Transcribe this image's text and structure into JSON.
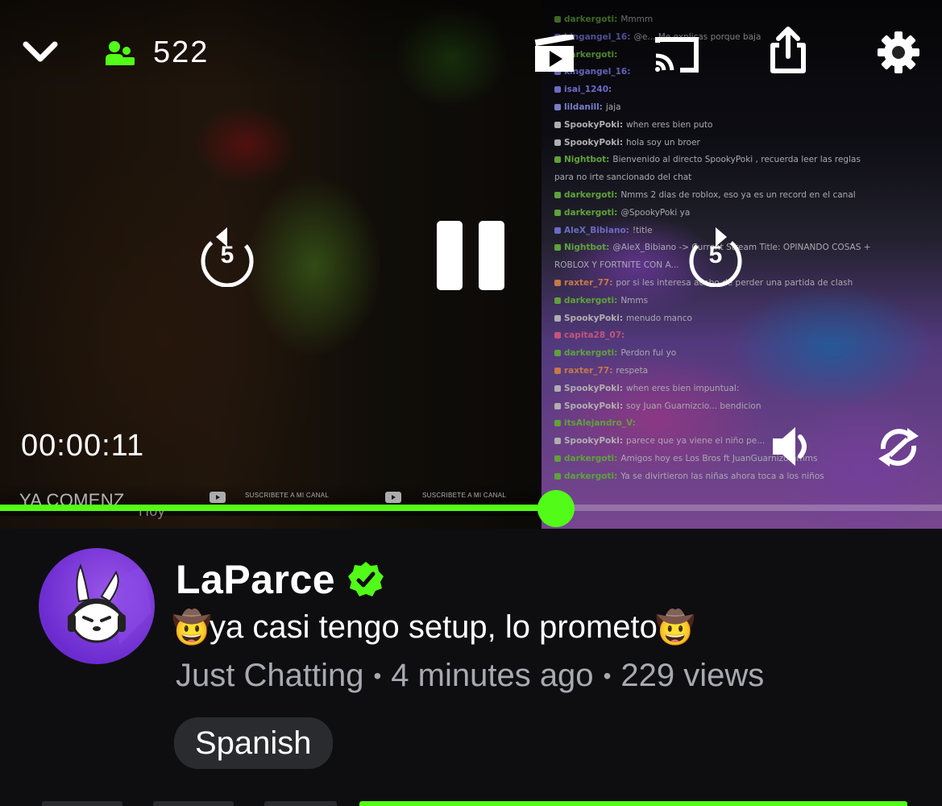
{
  "player": {
    "viewer_count": "522",
    "elapsed_time": "00:00:11",
    "rewind_seconds": "5",
    "forward_seconds": "5",
    "progress_fraction": 0.59,
    "banner": {
      "left_text": "YA COMENZ",
      "left_text_2": "Hoy",
      "subscribe_1": "SUSCRIBETE A MI CANAL",
      "subscribe_2": "SUSCRIBETE A MI CANAL"
    },
    "icons": {
      "collapse": "chevron-down-icon",
      "viewers": "viewers-icon",
      "clip": "clip-icon",
      "cast": "cast-icon",
      "share": "share-icon",
      "settings": "gear-icon",
      "rewind": "rewind-5-icon",
      "pause": "pause-icon",
      "forward": "forward-5-icon",
      "volume": "volume-icon",
      "rotate": "rotate-icon"
    }
  },
  "chat_overlay": [
    {
      "user": "darkergoti",
      "text": "Mmmm",
      "color": "#7ad04a"
    },
    {
      "user": "kingangel_16",
      "text": "@e... Me explicas porque baja",
      "color": "#8a8aff"
    },
    {
      "user": "darkergoti",
      "text": "",
      "color": "#7ad04a"
    },
    {
      "user": "kingangel_16",
      "text": "",
      "color": "#8a8aff"
    },
    {
      "user": "isai_1240",
      "text": "",
      "color": "#8a8aff"
    },
    {
      "user": "lildanill",
      "text": "jaja",
      "color": "#9aa0ff"
    },
    {
      "user": "SpookyPoki",
      "text": "when eres bien puto",
      "color": "#e0e0e0"
    },
    {
      "user": "SpookyPoki",
      "text": "hola soy un broer",
      "color": "#e0e0e0"
    },
    {
      "user": "Nightbot",
      "text": "Bienvenido al directo SpookyPoki , recuerda leer las reglas",
      "color": "#7ad04a"
    },
    {
      "user": "",
      "text": "para no irte sancionado del chat",
      "color": "#e0e0e0"
    },
    {
      "user": "darkergoti",
      "text": "Nmms 2 dias de roblox, eso ya es un record en el canal",
      "color": "#7ad04a"
    },
    {
      "user": "darkergoti",
      "text": "@SpookyPoki ya",
      "color": "#7ad04a"
    },
    {
      "user": "AleX_Bibiano",
      "text": "!title",
      "color": "#8a8aff"
    },
    {
      "user": "Nightbot",
      "text": "@AleX_Bibiano -> Current Stream Title: OPINANDO COSAS +",
      "color": "#7ad04a"
    },
    {
      "user": "",
      "text": "ROBLOX Y FORTNITE CON A...",
      "color": "#e0e0e0"
    },
    {
      "user": "raxter_77",
      "text": "por si les interesa acabo de perder una partida de clash",
      "color": "#ff9a5a"
    },
    {
      "user": "darkergoti",
      "text": "Nmms",
      "color": "#7ad04a"
    },
    {
      "user": "SpookyPoki",
      "text": "menudo manco",
      "color": "#e0e0e0"
    },
    {
      "user": "capita28_07",
      "text": "",
      "color": "#ff6aa0"
    },
    {
      "user": "darkergoti",
      "text": "Perdon fui yo",
      "color": "#7ad04a"
    },
    {
      "user": "raxter_77",
      "text": "respeta",
      "color": "#ff9a5a"
    },
    {
      "user": "SpookyPoki",
      "text": "when eres bien impuntual:",
      "color": "#e0e0e0"
    },
    {
      "user": "SpookyPoki",
      "text": "soy Juan Guarnizcio... bendicion",
      "color": "#e0e0e0"
    },
    {
      "user": "itsAlejandro_V",
      "text": "",
      "color": "#7ad04a"
    },
    {
      "user": "SpookyPoki",
      "text": "parece que ya viene el niño pe...",
      "color": "#e0e0e0"
    },
    {
      "user": "darkergoti",
      "text": "Amigos hoy es Los Bros ft JuanGuarnizo nmms",
      "color": "#7ad04a"
    },
    {
      "user": "darkergoti",
      "text": "Ya se divirtieron las niñas ahora toca a los niños",
      "color": "#7ad04a"
    }
  ],
  "channel": {
    "name": "LaParce",
    "verified_icon": "verified-badge-icon",
    "avatar_icon": "bunny-avatar-icon",
    "title_emoji": "🤠",
    "title_text": "ya casi tengo setup, lo prometo",
    "category": "Just Chatting",
    "separator": "•",
    "time_ago": "4 minutes ago",
    "views": "229 views",
    "language_tag": "Spanish"
  },
  "colors": {
    "accent": "#53fc18",
    "background": "#0e0e10",
    "muted_text": "#a9a9b2",
    "tag_bg": "#2a2b2f",
    "avatar_bg": "#7b36db"
  }
}
